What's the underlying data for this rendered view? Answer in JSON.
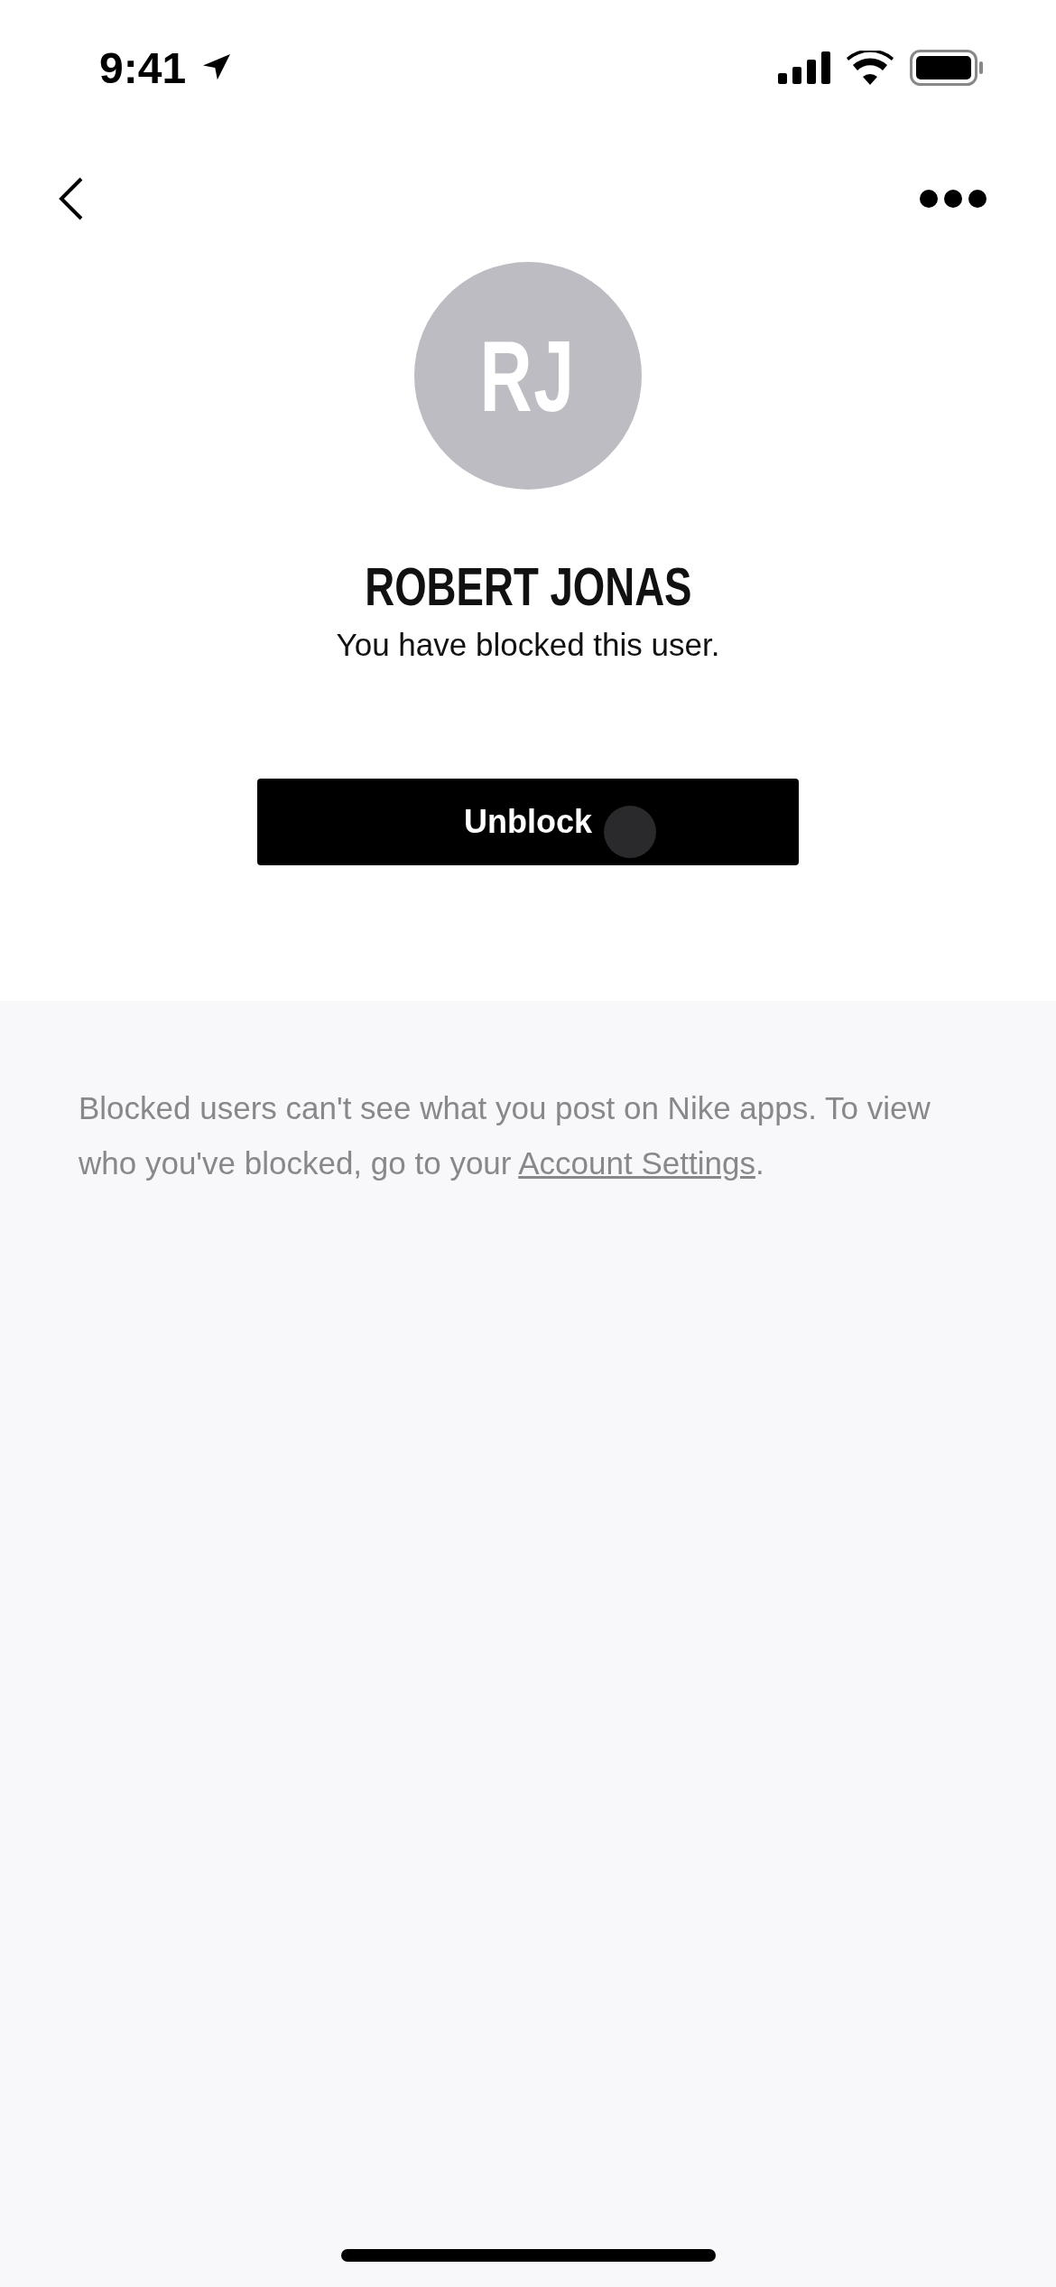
{
  "status_bar": {
    "time": "9:41"
  },
  "profile": {
    "initials": "RJ",
    "name": "ROBERT JONAS",
    "status": "You have blocked this user."
  },
  "unblock_button": {
    "label": "Unblock"
  },
  "info": {
    "text": "Blocked users can't see what you post on Nike apps. To view who you've blocked, go to your ",
    "link": "Account Settings",
    "after": "."
  }
}
